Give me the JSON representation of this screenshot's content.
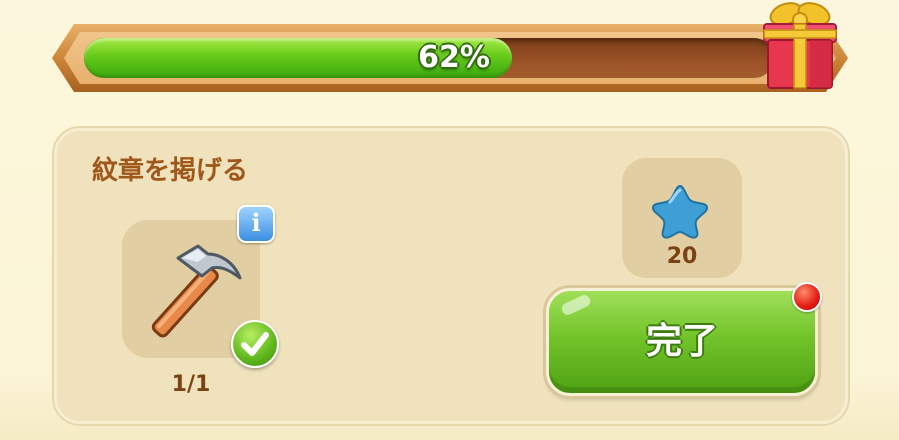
{
  "progress": {
    "label": "62%",
    "fraction": 0.62,
    "reward_icon": "gift-box-icon"
  },
  "task": {
    "title": "紋章を掲げる",
    "item": {
      "icon": "hammer-icon",
      "count_label": "1/1",
      "info_label": "i",
      "status_icon": "check-icon"
    },
    "reward": {
      "icon": "blue-star-icon",
      "amount": "20"
    },
    "complete_button": {
      "label": "完了",
      "notification_icon": "red-dot-icon"
    }
  },
  "colors": {
    "progress_fill": "#6ccd1c",
    "button_green": "#73c42b",
    "title_brown": "#a0581a",
    "notification_red": "#e21b10",
    "star_blue": "#3e9fd6"
  }
}
